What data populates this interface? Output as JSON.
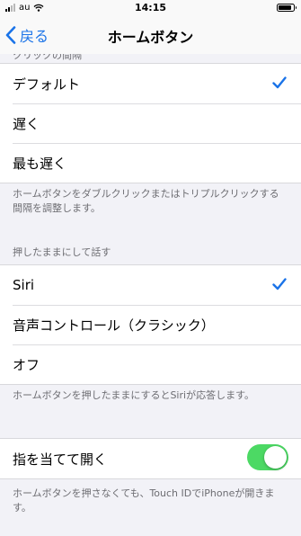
{
  "status_bar": {
    "carrier": "au",
    "time": "14:15",
    "signal_level": 0.5,
    "battery_level": 0.9
  },
  "nav": {
    "back_label": "戻る",
    "title": "ホームボタン"
  },
  "speed_section": {
    "header": "クリックの間隔",
    "options": [
      {
        "label": "デフォルト",
        "selected": true
      },
      {
        "label": "遅く",
        "selected": false
      },
      {
        "label": "最も遅く",
        "selected": false
      }
    ],
    "footer": "ホームボタンをダブルクリックまたはトリプルクリックする間隔を調整します。"
  },
  "press_hold_section": {
    "header": "押したままにして話す",
    "options": [
      {
        "label": "Siri",
        "selected": true
      },
      {
        "label": "音声コントロール（クラシック）",
        "selected": false
      },
      {
        "label": "オフ",
        "selected": false
      }
    ],
    "footer": "ホームボタンを押したままにするとSiriが応答します。"
  },
  "rest_finger_section": {
    "label": "指を当てて開く",
    "enabled": true,
    "footer": "ホームボタンを押さなくても、Touch IDでiPhoneが開きます。"
  },
  "colors": {
    "accent": "#1a73e8",
    "toggle_on": "#4cd964"
  }
}
